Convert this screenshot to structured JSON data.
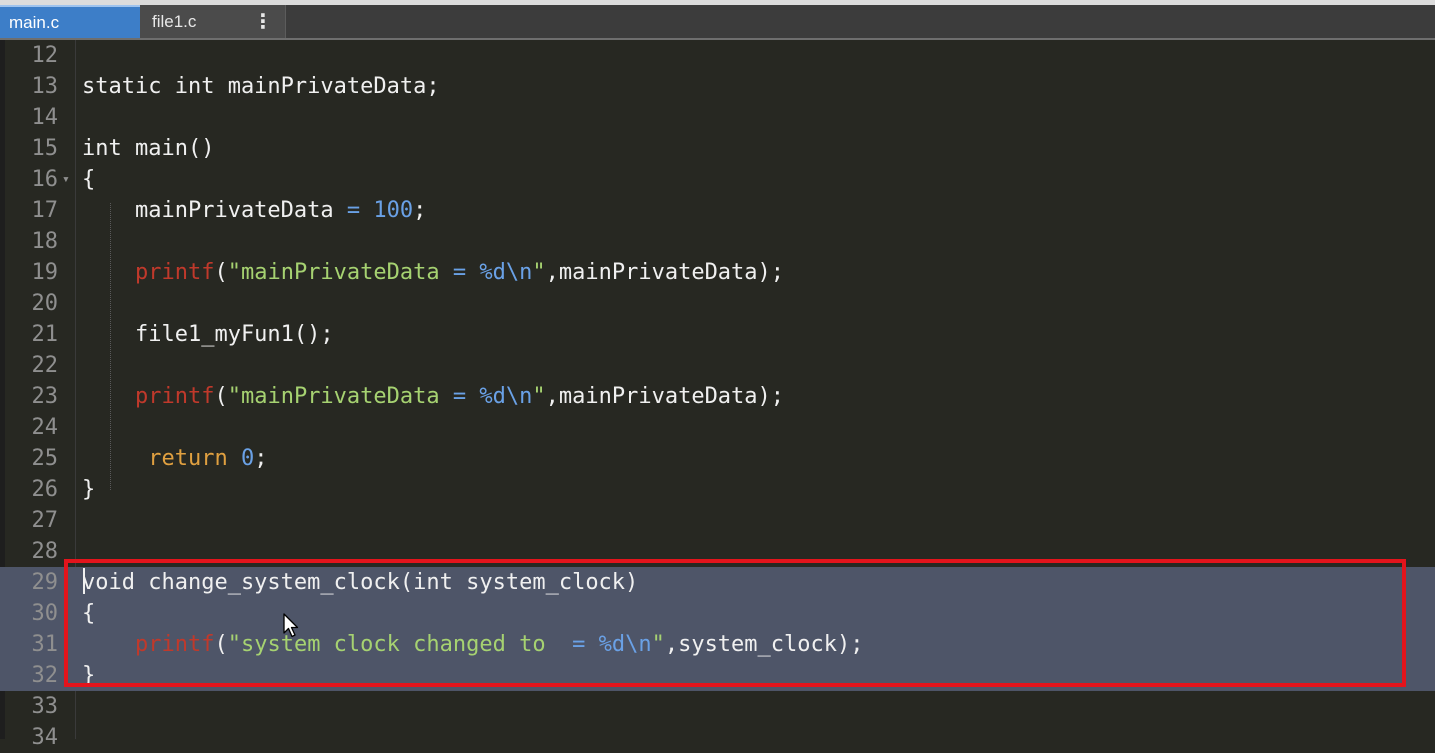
{
  "tabs": [
    {
      "label": "main.c",
      "active": true
    },
    {
      "label": "file1.c",
      "active": false
    }
  ],
  "tab_menu_glyph": "⋮",
  "lines": [
    {
      "num": "12",
      "tokens": []
    },
    {
      "num": "13",
      "tokens": [
        {
          "t": "static int mainPrivateData;",
          "c": "pl"
        }
      ]
    },
    {
      "num": "14",
      "tokens": []
    },
    {
      "num": "15",
      "tokens": [
        {
          "t": "int main()",
          "c": "pl"
        }
      ]
    },
    {
      "num": "16",
      "tokens": [
        {
          "t": "{",
          "c": "pl"
        }
      ],
      "fold": true
    },
    {
      "num": "17",
      "tokens": [
        {
          "t": "    mainPrivateData ",
          "c": "pl"
        },
        {
          "t": "=",
          "c": "op"
        },
        {
          "t": " ",
          "c": "pl"
        },
        {
          "t": "100",
          "c": "num"
        },
        {
          "t": ";",
          "c": "pl"
        }
      ]
    },
    {
      "num": "18",
      "tokens": []
    },
    {
      "num": "19",
      "tokens": [
        {
          "t": "    ",
          "c": "pl"
        },
        {
          "t": "printf",
          "c": "fn"
        },
        {
          "t": "(",
          "c": "pl"
        },
        {
          "t": "\"mainPrivateData ",
          "c": "str"
        },
        {
          "t": "=",
          "c": "op"
        },
        {
          "t": " ",
          "c": "str"
        },
        {
          "t": "%d\\n",
          "c": "fmt"
        },
        {
          "t": "\"",
          "c": "str"
        },
        {
          "t": ",mainPrivateData);",
          "c": "pl"
        }
      ]
    },
    {
      "num": "20",
      "tokens": []
    },
    {
      "num": "21",
      "tokens": [
        {
          "t": "    file1_myFun1();",
          "c": "pl"
        }
      ]
    },
    {
      "num": "22",
      "tokens": []
    },
    {
      "num": "23",
      "tokens": [
        {
          "t": "    ",
          "c": "pl"
        },
        {
          "t": "printf",
          "c": "fn"
        },
        {
          "t": "(",
          "c": "pl"
        },
        {
          "t": "\"mainPrivateData ",
          "c": "str"
        },
        {
          "t": "=",
          "c": "op"
        },
        {
          "t": " ",
          "c": "str"
        },
        {
          "t": "%d\\n",
          "c": "fmt"
        },
        {
          "t": "\"",
          "c": "str"
        },
        {
          "t": ",mainPrivateData);",
          "c": "pl"
        }
      ]
    },
    {
      "num": "24",
      "tokens": []
    },
    {
      "num": "25",
      "tokens": [
        {
          "t": "     ",
          "c": "pl"
        },
        {
          "t": "return",
          "c": "ret"
        },
        {
          "t": " ",
          "c": "pl"
        },
        {
          "t": "0",
          "c": "num"
        },
        {
          "t": ";",
          "c": "pl"
        }
      ]
    },
    {
      "num": "26",
      "tokens": [
        {
          "t": "}",
          "c": "pl"
        }
      ]
    },
    {
      "num": "27",
      "tokens": []
    },
    {
      "num": "28",
      "tokens": []
    },
    {
      "num": "29",
      "tokens": [
        {
          "t": "void change_system_clock(int system_clock)",
          "c": "pl"
        }
      ],
      "selected": true
    },
    {
      "num": "30",
      "tokens": [
        {
          "t": "{",
          "c": "pl"
        }
      ],
      "selected": true
    },
    {
      "num": "31",
      "tokens": [
        {
          "t": "    ",
          "c": "pl"
        },
        {
          "t": "printf",
          "c": "fn"
        },
        {
          "t": "(",
          "c": "pl"
        },
        {
          "t": "\"system clock changed to  ",
          "c": "str"
        },
        {
          "t": "=",
          "c": "op"
        },
        {
          "t": " ",
          "c": "str"
        },
        {
          "t": "%d\\n",
          "c": "fmt"
        },
        {
          "t": "\"",
          "c": "str"
        },
        {
          "t": ",system_clock);",
          "c": "pl"
        }
      ],
      "selected": true
    },
    {
      "num": "32",
      "tokens": [
        {
          "t": "}",
          "c": "pl"
        }
      ],
      "selected": true
    },
    {
      "num": "33",
      "tokens": []
    },
    {
      "num": "34",
      "tokens": []
    }
  ],
  "colors": {
    "background": "#272822",
    "selection": "#4e5568",
    "highlight_box": "#e3141c",
    "active_tab": "#3d7ec8"
  }
}
